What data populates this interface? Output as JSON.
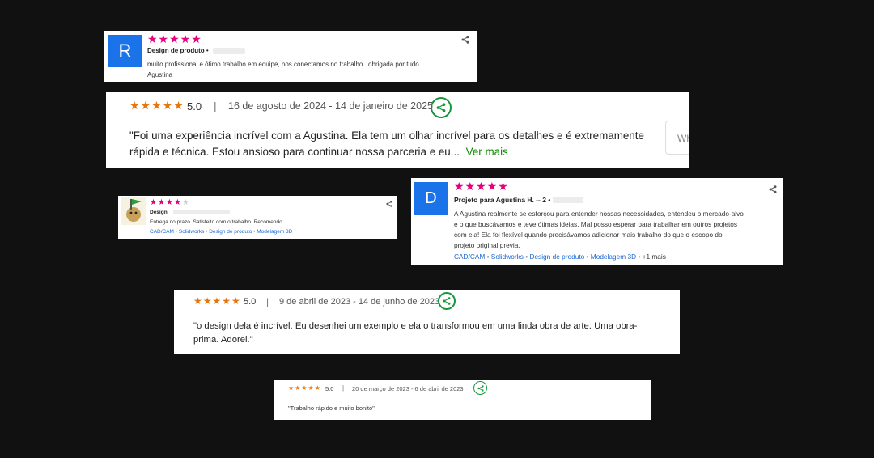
{
  "colors": {
    "background": "#111111",
    "pink_stars": "#e5007e",
    "orange_stars": "#e8740c",
    "share_green": "#17963b",
    "link_blue": "#1a67d2",
    "avatar_blue": "#1a73e8"
  },
  "icons": {
    "share": "share-icon",
    "star": "star-icon"
  },
  "card1": {
    "avatar_letter": "R",
    "rating": 5,
    "stars": "★★★★★",
    "category": "Design de produto",
    "category_suffix": "•",
    "text": "muito profissional e ótimo trabalho em equipe, nos conectamos no trabalho...obrigada por tudo",
    "signature": "Agustina"
  },
  "card2": {
    "rating": 5,
    "stars": "★★★★★",
    "score": "5.0",
    "separator": "|",
    "dates": "16 de agosto de 2024 - 14 de janeiro de 2025",
    "text_line1": "\"Foi uma experiência incrível com a Agustina. Ela tem um olhar incrível para os detalhes e é extremamente",
    "text_line2": "rápida e técnica. Estou ansioso para continuar nossa parceria e eu...",
    "see_more": "Ver mais",
    "side_text": "Wh"
  },
  "card3": {
    "rating": 4,
    "stars_filled": "★★★★",
    "stars_empty": "★",
    "category": "Design",
    "text": "Entrega no prazo. Satisfeito com o trabalho. Recomendo.",
    "tags": [
      "CAD/CAM",
      "Solidworks",
      "Design de produto",
      "Modelagem 3D"
    ],
    "tag_sep": "•"
  },
  "card4": {
    "avatar_letter": "D",
    "rating": 5,
    "stars": "★★★★★",
    "title": "Projeto para Agustina H. -- 2 •",
    "text_lines": [
      "A Agustina realmente se esforçou para entender nossas necessidades, entendeu o mercado-alvo",
      "e o que buscávamos e teve ótimas ideias. Mal posso esperar para trabalhar em outros projetos",
      "com ela! Ela foi flexível quando precisávamos adicionar mais trabalho do que o escopo do",
      "projeto original previa."
    ],
    "tags": [
      "CAD/CAM",
      "Solidworks",
      "Design de produto",
      "Modelagem 3D"
    ],
    "tag_sep": "•",
    "more": "+1 mais"
  },
  "card5": {
    "rating": 5,
    "stars": "★★★★★",
    "score": "5.0",
    "separator": "|",
    "dates": "9 de abril de 2023 - 14 de junho de 2023",
    "text_line1": "\"o design dela é incrível. Eu desenhei um exemplo e ela o transformou em uma linda obra de arte. Uma obra-",
    "text_line2": "prima. Adorei.\""
  },
  "card6": {
    "rating": 5,
    "stars": "★★★★★",
    "score": "5.0",
    "separator": "|",
    "dates": "20 de março de 2023 - 6 de abril de 2023",
    "text": "\"Trabalho rápido e muito bonito\""
  }
}
